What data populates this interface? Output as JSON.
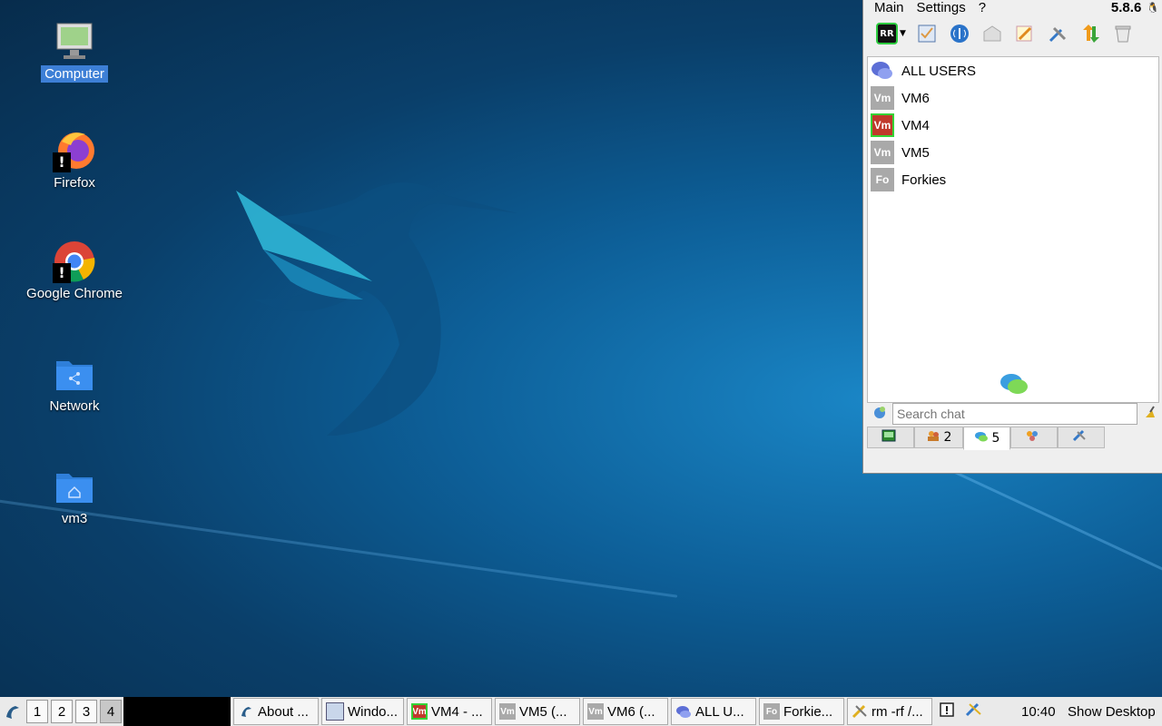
{
  "desktop": {
    "icons": [
      {
        "label": "Computer"
      },
      {
        "label": "Firefox"
      },
      {
        "label": "Google Chrome"
      },
      {
        "label": "Network"
      },
      {
        "label": "vm3"
      }
    ]
  },
  "chat_window": {
    "menu": {
      "main": "Main",
      "settings": "Settings",
      "help": "?",
      "version": "5.8.6"
    },
    "toolbar": {
      "rr_label": "RR"
    },
    "users": [
      {
        "name": "ALL USERS",
        "avatar": ""
      },
      {
        "name": "VM6",
        "avatar": "Vm"
      },
      {
        "name": "VM4",
        "avatar": "Vm"
      },
      {
        "name": "VM5",
        "avatar": "Vm"
      },
      {
        "name": "Forkies",
        "avatar": "Fo"
      }
    ],
    "search": {
      "placeholder": "Search chat"
    },
    "tabs": [
      {
        "count": ""
      },
      {
        "count": "2"
      },
      {
        "count": "5"
      },
      {
        "count": ""
      },
      {
        "count": ""
      }
    ]
  },
  "taskbar": {
    "workspaces": [
      "1",
      "2",
      "3",
      "4"
    ],
    "tasks": [
      {
        "label": "About ...",
        "icon": ""
      },
      {
        "label": "Windo...",
        "icon": ""
      },
      {
        "label": "VM4 - ...",
        "icon": "Vm"
      },
      {
        "label": "VM5 (...",
        "icon": "Vm"
      },
      {
        "label": "VM6 (...",
        "icon": "Vm"
      },
      {
        "label": "ALL U...",
        "icon": ""
      },
      {
        "label": "Forkie...",
        "icon": "Fo"
      },
      {
        "label": "rm -rf /...",
        "icon": ""
      }
    ],
    "clock": "10:40",
    "show_desktop": "Show Desktop"
  }
}
